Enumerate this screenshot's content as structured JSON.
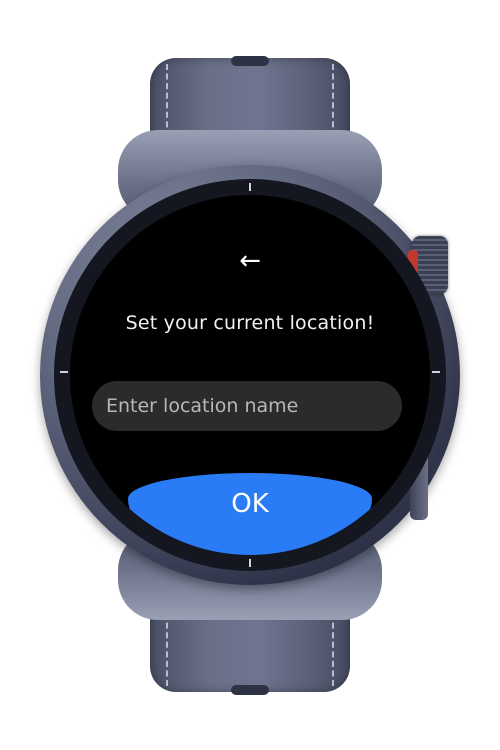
{
  "screen": {
    "back_icon": "arrow-left-icon",
    "back_glyph": "←",
    "title": "Set your current location!",
    "location_input": {
      "placeholder": "Enter location name",
      "value": ""
    },
    "ok_label": "OK"
  },
  "colors": {
    "ok_button": "#2a7bf6",
    "input_background": "#2b2b2b",
    "screen_background": "#000000",
    "text": "#f2f2f2"
  }
}
